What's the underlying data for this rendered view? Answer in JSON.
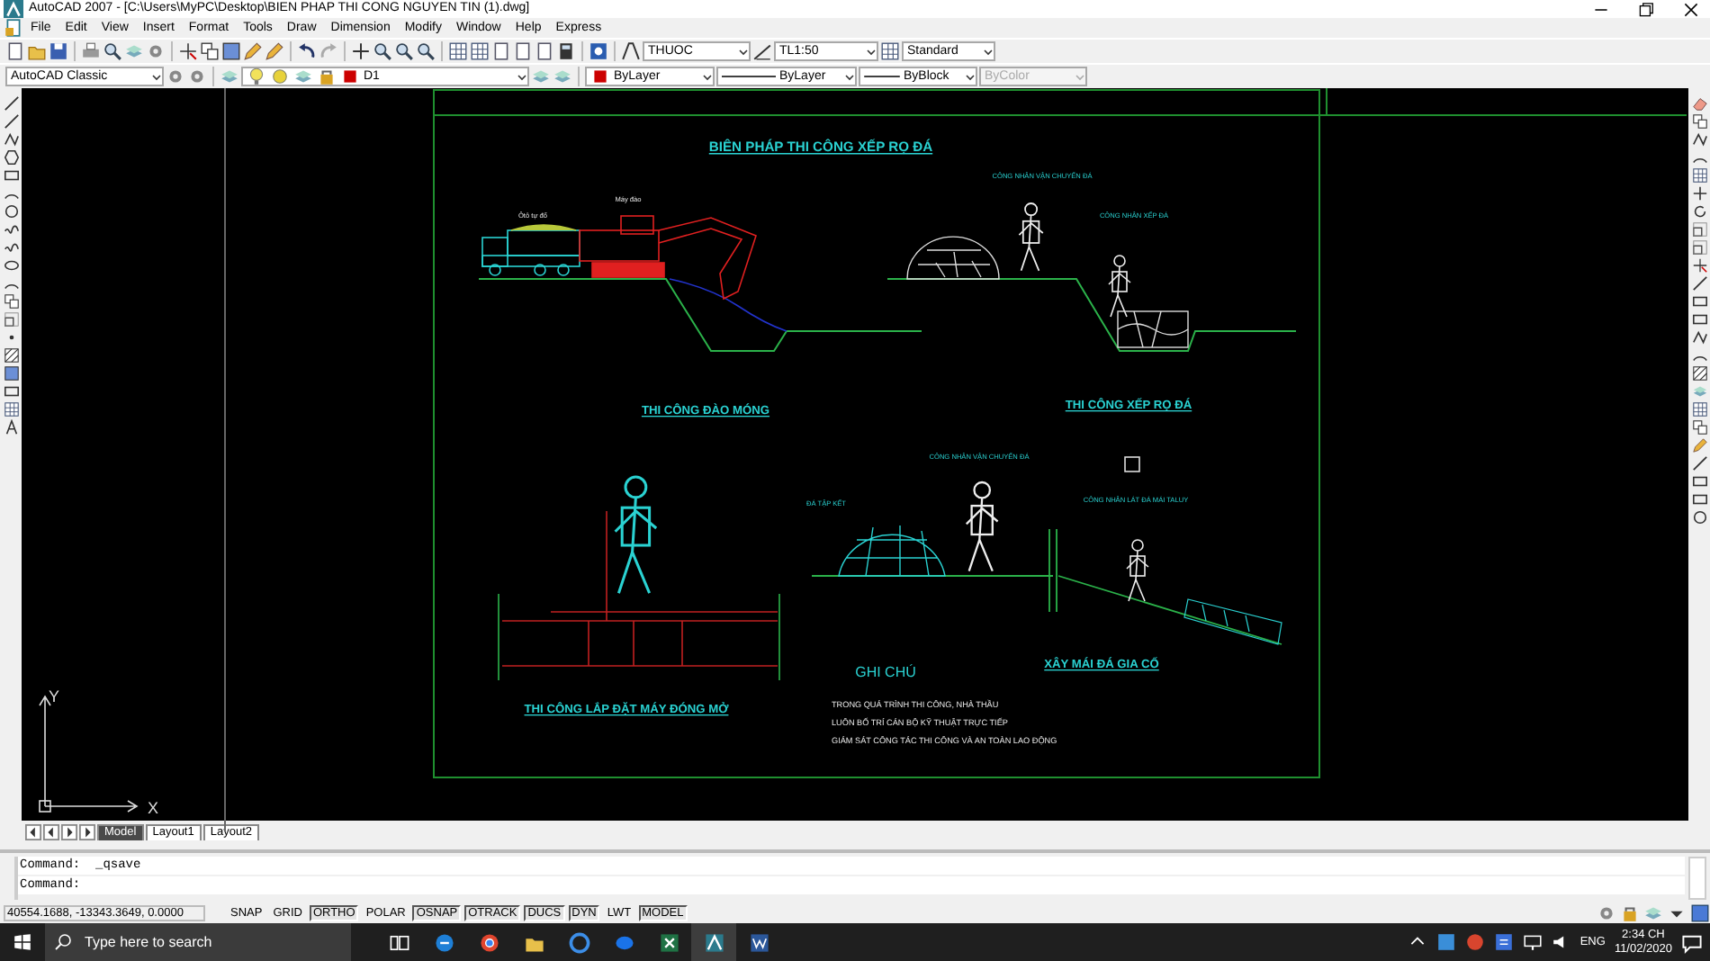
{
  "window": {
    "title": "AutoCAD 2007 - [C:\\Users\\MyPC\\Desktop\\BIEN PHAP THI CONG NGUYEN TIN (1).dwg]"
  },
  "menu": [
    "File",
    "Edit",
    "View",
    "Insert",
    "Format",
    "Tools",
    "Draw",
    "Dimension",
    "Modify",
    "Window",
    "Help",
    "Express"
  ],
  "styles_toolbar": {
    "text_style": "THUOC",
    "dim_style": "TL1:50",
    "table_style": "Standard"
  },
  "workspace": "AutoCAD Classic",
  "layer": "D1",
  "properties": [
    {
      "kind": "color",
      "value": "ByLayer",
      "disabled": false
    },
    {
      "kind": "linetype",
      "value": "ByLayer",
      "disabled": false
    },
    {
      "kind": "lineweight",
      "value": "ByBlock",
      "disabled": false
    },
    {
      "kind": "plotstyle",
      "value": "ByColor",
      "disabled": true
    }
  ],
  "drawing": {
    "labels": [
      {
        "kind": "heading",
        "text": "BIÊN PHÁP THI CÔNG XẾP RỌ ĐÁ"
      },
      {
        "kind": "callout",
        "text": "Ôtô tự đổ"
      },
      {
        "kind": "callout",
        "text": "Máy đào"
      },
      {
        "kind": "callout",
        "text": "CÔNG NHÂN VẬN CHUYỂN ĐÁ"
      },
      {
        "kind": "callout",
        "text": "CÔNG NHÂN XẾP ĐÁ"
      },
      {
        "kind": "caption",
        "text": "THI CÔNG ĐÀO MÓNG"
      },
      {
        "kind": "caption",
        "text": "THI CÔNG XẾP RỌ ĐÁ"
      },
      {
        "kind": "callout",
        "text": "CÔNG NHÂN VẬN CHUYỂN ĐÁ"
      },
      {
        "kind": "callout",
        "text": "ĐÁ TẬP KẾT"
      },
      {
        "kind": "callout",
        "text": "CÔNG NHÂN LÁT ĐÁ MÁI TALUY"
      },
      {
        "kind": "caption",
        "text": "THI CÔNG LẮP ĐẶT MÁY ĐÓNG MỞ"
      },
      {
        "kind": "notes_heading",
        "text": "GHI CHÚ"
      },
      {
        "kind": "caption",
        "text": "XÂY MÁI ĐÁ GIA CỐ"
      },
      {
        "kind": "note",
        "text": "TRONG QUÁ TRÌNH THI CÔNG, NHÀ THẦU"
      },
      {
        "kind": "note",
        "text": "LUÔN BỐ TRÍ CÁN BỘ KỸ THUẬT TRỰC TIẾP"
      },
      {
        "kind": "note",
        "text": "GIÁM SÁT CÔNG TÁC THI CÔNG VÀ AN TOÀN LAO ĐỘNG"
      }
    ]
  },
  "ucs": {
    "y": "Y",
    "x": "X"
  },
  "layout_tabs": [
    {
      "label": "Model",
      "selected": true
    },
    {
      "label": "Layout1",
      "selected": false
    },
    {
      "label": "Layout2",
      "selected": false
    }
  ],
  "command_lines": [
    "Command:  _qsave",
    "Command:"
  ],
  "status_bar": {
    "coordinates": "40554.1688, -13343.3649, 0.0000",
    "toggles": [
      {
        "label": "SNAP",
        "on": false
      },
      {
        "label": "GRID",
        "on": false
      },
      {
        "label": "ORTHO",
        "on": true
      },
      {
        "label": "POLAR",
        "on": false
      },
      {
        "label": "OSNAP",
        "on": true
      },
      {
        "label": "OTRACK",
        "on": true
      },
      {
        "label": "DUCS",
        "on": true
      },
      {
        "label": "DYN",
        "on": true
      },
      {
        "label": "LWT",
        "on": false
      },
      {
        "label": "MODEL",
        "on": true
      }
    ]
  },
  "taskbar": {
    "search_placeholder": "Type here to search",
    "language": "ENG",
    "time": "2:34 CH",
    "date": "11/02/2020"
  }
}
